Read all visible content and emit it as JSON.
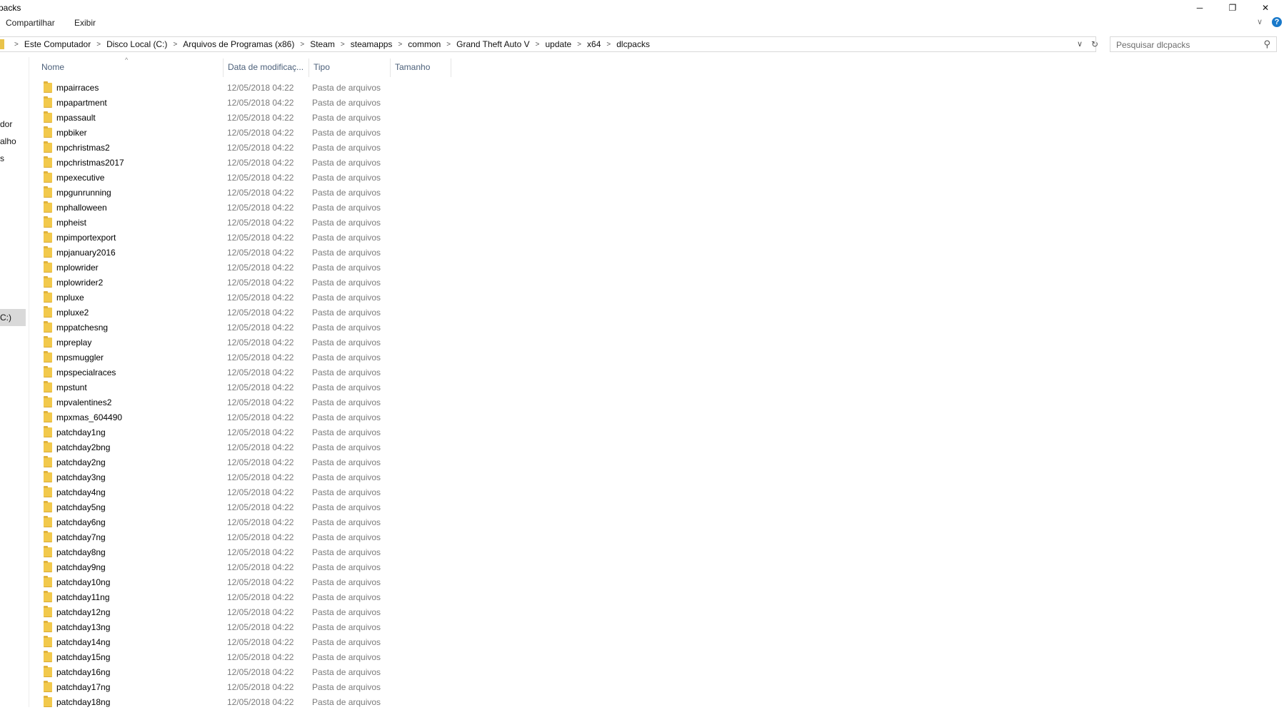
{
  "window": {
    "title": "packs",
    "minimize_glyph": "─",
    "restore_glyph": "❐",
    "close_glyph": "✕"
  },
  "ribbon": {
    "tabs": [
      "Compartilhar",
      "Exibir"
    ],
    "expand_glyph": "∨",
    "help_glyph": "?"
  },
  "address": {
    "breadcrumbs": [
      "Este Computador",
      "Disco Local (C:)",
      "Arquivos de Programas (x86)",
      "Steam",
      "steamapps",
      "common",
      "Grand Theft Auto V",
      "update",
      "x64",
      "dlcpacks"
    ],
    "separator_glyph": ">",
    "dropdown_glyph": "∨",
    "refresh_glyph": "↻"
  },
  "search": {
    "placeholder": "Pesquisar dlcpacks",
    "icon": "search-icon",
    "icon_glyph": "⚲"
  },
  "nav_pane": {
    "items": [
      "dor",
      "alho",
      "s",
      "C:)"
    ],
    "selected_item": "C:)"
  },
  "columns": {
    "name": "Nome",
    "date": "Data de modificaç...",
    "type": "Tipo",
    "size": "Tamanho",
    "sort_glyph": "^"
  },
  "files": [
    {
      "name": "mpairraces",
      "date": "12/05/2018 04:22",
      "type": "Pasta de arquivos"
    },
    {
      "name": "mpapartment",
      "date": "12/05/2018 04:22",
      "type": "Pasta de arquivos"
    },
    {
      "name": "mpassault",
      "date": "12/05/2018 04:22",
      "type": "Pasta de arquivos"
    },
    {
      "name": "mpbiker",
      "date": "12/05/2018 04:22",
      "type": "Pasta de arquivos"
    },
    {
      "name": "mpchristmas2",
      "date": "12/05/2018 04:22",
      "type": "Pasta de arquivos"
    },
    {
      "name": "mpchristmas2017",
      "date": "12/05/2018 04:22",
      "type": "Pasta de arquivos"
    },
    {
      "name": "mpexecutive",
      "date": "12/05/2018 04:22",
      "type": "Pasta de arquivos"
    },
    {
      "name": "mpgunrunning",
      "date": "12/05/2018 04:22",
      "type": "Pasta de arquivos"
    },
    {
      "name": "mphalloween",
      "date": "12/05/2018 04:22",
      "type": "Pasta de arquivos"
    },
    {
      "name": "mpheist",
      "date": "12/05/2018 04:22",
      "type": "Pasta de arquivos"
    },
    {
      "name": "mpimportexport",
      "date": "12/05/2018 04:22",
      "type": "Pasta de arquivos"
    },
    {
      "name": "mpjanuary2016",
      "date": "12/05/2018 04:22",
      "type": "Pasta de arquivos"
    },
    {
      "name": "mplowrider",
      "date": "12/05/2018 04:22",
      "type": "Pasta de arquivos"
    },
    {
      "name": "mplowrider2",
      "date": "12/05/2018 04:22",
      "type": "Pasta de arquivos"
    },
    {
      "name": "mpluxe",
      "date": "12/05/2018 04:22",
      "type": "Pasta de arquivos"
    },
    {
      "name": "mpluxe2",
      "date": "12/05/2018 04:22",
      "type": "Pasta de arquivos"
    },
    {
      "name": "mppatchesng",
      "date": "12/05/2018 04:22",
      "type": "Pasta de arquivos"
    },
    {
      "name": "mpreplay",
      "date": "12/05/2018 04:22",
      "type": "Pasta de arquivos"
    },
    {
      "name": "mpsmuggler",
      "date": "12/05/2018 04:22",
      "type": "Pasta de arquivos"
    },
    {
      "name": "mpspecialraces",
      "date": "12/05/2018 04:22",
      "type": "Pasta de arquivos"
    },
    {
      "name": "mpstunt",
      "date": "12/05/2018 04:22",
      "type": "Pasta de arquivos"
    },
    {
      "name": "mpvalentines2",
      "date": "12/05/2018 04:22",
      "type": "Pasta de arquivos"
    },
    {
      "name": "mpxmas_604490",
      "date": "12/05/2018 04:22",
      "type": "Pasta de arquivos"
    },
    {
      "name": "patchday1ng",
      "date": "12/05/2018 04:22",
      "type": "Pasta de arquivos"
    },
    {
      "name": "patchday2bng",
      "date": "12/05/2018 04:22",
      "type": "Pasta de arquivos"
    },
    {
      "name": "patchday2ng",
      "date": "12/05/2018 04:22",
      "type": "Pasta de arquivos"
    },
    {
      "name": "patchday3ng",
      "date": "12/05/2018 04:22",
      "type": "Pasta de arquivos"
    },
    {
      "name": "patchday4ng",
      "date": "12/05/2018 04:22",
      "type": "Pasta de arquivos"
    },
    {
      "name": "patchday5ng",
      "date": "12/05/2018 04:22",
      "type": "Pasta de arquivos"
    },
    {
      "name": "patchday6ng",
      "date": "12/05/2018 04:22",
      "type": "Pasta de arquivos"
    },
    {
      "name": "patchday7ng",
      "date": "12/05/2018 04:22",
      "type": "Pasta de arquivos"
    },
    {
      "name": "patchday8ng",
      "date": "12/05/2018 04:22",
      "type": "Pasta de arquivos"
    },
    {
      "name": "patchday9ng",
      "date": "12/05/2018 04:22",
      "type": "Pasta de arquivos"
    },
    {
      "name": "patchday10ng",
      "date": "12/05/2018 04:22",
      "type": "Pasta de arquivos"
    },
    {
      "name": "patchday11ng",
      "date": "12/05/2018 04:22",
      "type": "Pasta de arquivos"
    },
    {
      "name": "patchday12ng",
      "date": "12/05/2018 04:22",
      "type": "Pasta de arquivos"
    },
    {
      "name": "patchday13ng",
      "date": "12/05/2018 04:22",
      "type": "Pasta de arquivos"
    },
    {
      "name": "patchday14ng",
      "date": "12/05/2018 04:22",
      "type": "Pasta de arquivos"
    },
    {
      "name": "patchday15ng",
      "date": "12/05/2018 04:22",
      "type": "Pasta de arquivos"
    },
    {
      "name": "patchday16ng",
      "date": "12/05/2018 04:22",
      "type": "Pasta de arquivos"
    },
    {
      "name": "patchday17ng",
      "date": "12/05/2018 04:22",
      "type": "Pasta de arquivos"
    },
    {
      "name": "patchday18ng",
      "date": "12/05/2018 04:22",
      "type": "Pasta de arquivos"
    }
  ],
  "colors": {
    "folder": "#f2c94c",
    "header_text": "#4c607a",
    "selected_nav": "#d9d9d9",
    "help_icon": "#1979ca"
  }
}
